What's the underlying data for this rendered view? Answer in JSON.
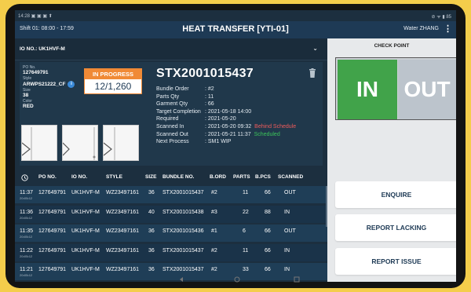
{
  "statusbar": {
    "left": "14:28 ▣ ▣ ▣ ⬆",
    "right": "⊘ ᯤ ▮ 85"
  },
  "titlebar": {
    "shift": "Shift 01: 08:00 - 17:59",
    "title": "HEAT TRANSFER [YTI-01]",
    "user": "Water ZHANG"
  },
  "io_selector": {
    "label": "IO NO.: UK1HVF-M"
  },
  "order": {
    "po_label": "PO No.",
    "po": "127649791",
    "style_label": "Style",
    "style": "ARWPS21222_CF",
    "size_label": "Size",
    "size": "38",
    "color_label": "Color",
    "color": "RED"
  },
  "progress": {
    "status": "IN PROGRESS",
    "count": "12/1,260",
    "fraction": 0.0095
  },
  "bundle": {
    "id": "STX2001015437",
    "rows": [
      {
        "k": "Bundle Order",
        "v": ": #2",
        "note": "",
        "note_color": ""
      },
      {
        "k": "Parts Qty",
        "v": ": 11",
        "note": "",
        "note_color": ""
      },
      {
        "k": "Garment Qty",
        "v": ": 66",
        "note": "",
        "note_color": ""
      },
      {
        "k": "Target Completion",
        "v": ": 2021-05-18 14:00",
        "note": "",
        "note_color": ""
      },
      {
        "k": "Required",
        "v": ": 2021-05-20",
        "note": "",
        "note_color": ""
      },
      {
        "k": "Scanned In",
        "v": ": 2021-05-20 09:32",
        "note": "Behind Schedule",
        "note_color": "#ef5b5b"
      },
      {
        "k": "Scanned Out",
        "v": ": 2021-05-21 11:37",
        "note": "Scheduled",
        "note_color": "#3cc45a"
      },
      {
        "k": "Next Process",
        "v": ": SM1 WIP",
        "note": "",
        "note_color": ""
      }
    ]
  },
  "table": {
    "headers": [
      "",
      "PO NO.",
      "IO NO.",
      "STYLE",
      "SIZE",
      "BUNDLE NO.",
      "B.ORD",
      "PARTS",
      "B.PCS",
      "SCANNED"
    ],
    "rows": [
      {
        "time": "11:37",
        "date": "20•05•12",
        "po": "127649791",
        "io": "UK1HVF-M",
        "style": "WZ23497161",
        "size": "36",
        "bundle": "STX2001015437",
        "bord": "#2",
        "parts": "11",
        "bpcs": "66",
        "scanned": "OUT"
      },
      {
        "time": "11:36",
        "date": "20•05•12",
        "po": "127649791",
        "io": "UK1HVF-M",
        "style": "WZ23497161",
        "size": "40",
        "bundle": "STX2001015438",
        "bord": "#3",
        "parts": "22",
        "bpcs": "88",
        "scanned": "IN"
      },
      {
        "time": "11:35",
        "date": "20•05•12",
        "po": "127649791",
        "io": "UK1HVF-M",
        "style": "WZ23497161",
        "size": "36",
        "bundle": "STX2001015436",
        "bord": "#1",
        "parts": "6",
        "bpcs": "66",
        "scanned": "OUT"
      },
      {
        "time": "11:22",
        "date": "20•05•12",
        "po": "127649791",
        "io": "UK1HVF-M",
        "style": "WZ23497161",
        "size": "36",
        "bundle": "STX2001015437",
        "bord": "#2",
        "parts": "11",
        "bpcs": "66",
        "scanned": "IN"
      },
      {
        "time": "11:21",
        "date": "20•05•12",
        "po": "127649791",
        "io": "UK1HVF-M",
        "style": "WZ23497161",
        "size": "36",
        "bundle": "STX2001015437",
        "bord": "#2",
        "parts": "33",
        "bpcs": "66",
        "scanned": "IN"
      }
    ]
  },
  "checkpoint": {
    "title": "CHECK POINT",
    "in_label": "IN",
    "out_label": "OUT"
  },
  "actions": {
    "enquire": "ENQUIRE",
    "report_lacking": "REPORT LACKING",
    "report_issue": "REPORT ISSUE"
  },
  "colors": {
    "header": "#1e3a55",
    "in_green": "#41a34a",
    "progress_orange": "#f08a36",
    "row_even": "#1f3e57",
    "row_odd": "#1a3349"
  }
}
